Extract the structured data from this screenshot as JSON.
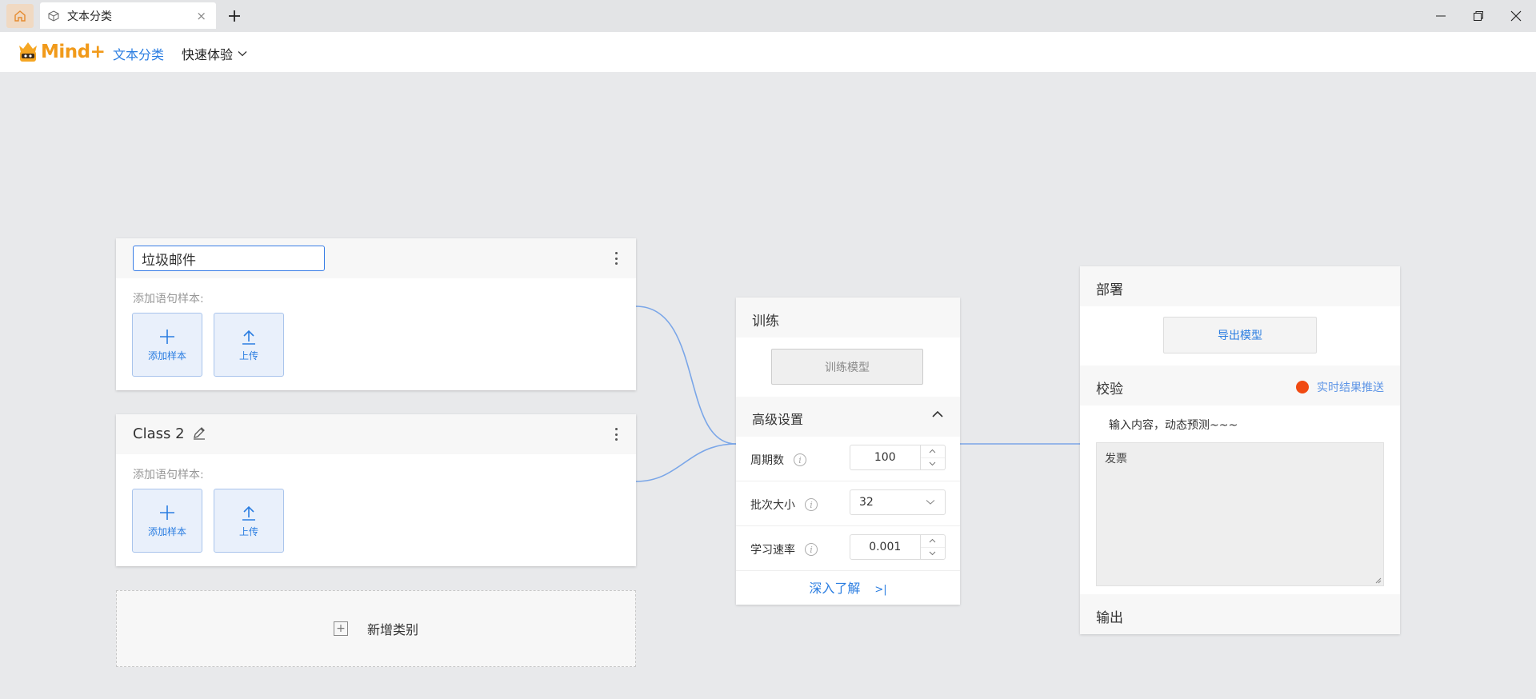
{
  "tab": {
    "title": "文本分类",
    "close": "×"
  },
  "header": {
    "logo_text": "Mind+",
    "nav_active": "文本分类",
    "nav_quick": "快速体验"
  },
  "classes": [
    {
      "name": "垃圾邮件",
      "editing": true,
      "samples_label": "添加语句样本:",
      "add_sample": "添加样本",
      "upload": "上传"
    },
    {
      "name": "Class 2",
      "editing": false,
      "samples_label": "添加语句样本:",
      "add_sample": "添加样本",
      "upload": "上传"
    }
  ],
  "add_class": "新增类别",
  "train": {
    "title": "训练",
    "button": "训练模型",
    "advanced_title": "高级设置",
    "params": [
      {
        "label": "周期数",
        "value": "100",
        "kind": "stepper"
      },
      {
        "label": "批次大小",
        "value": "32",
        "kind": "select"
      },
      {
        "label": "学习速率",
        "value": "0.001",
        "kind": "stepper"
      }
    ],
    "learn_more": "深入了解",
    "learn_more_arrow": ">|"
  },
  "deploy": {
    "title": "部署",
    "export_button": "导出模型",
    "verify_title": "校验",
    "realtime_label": "实时结果推送",
    "realtime_color": "#f04a12",
    "hint": "输入内容，动态预测~~~",
    "test_value": "发票",
    "output_title": "输出"
  },
  "colors": {
    "accent": "#2a7de1",
    "brand": "#f19a1a"
  }
}
